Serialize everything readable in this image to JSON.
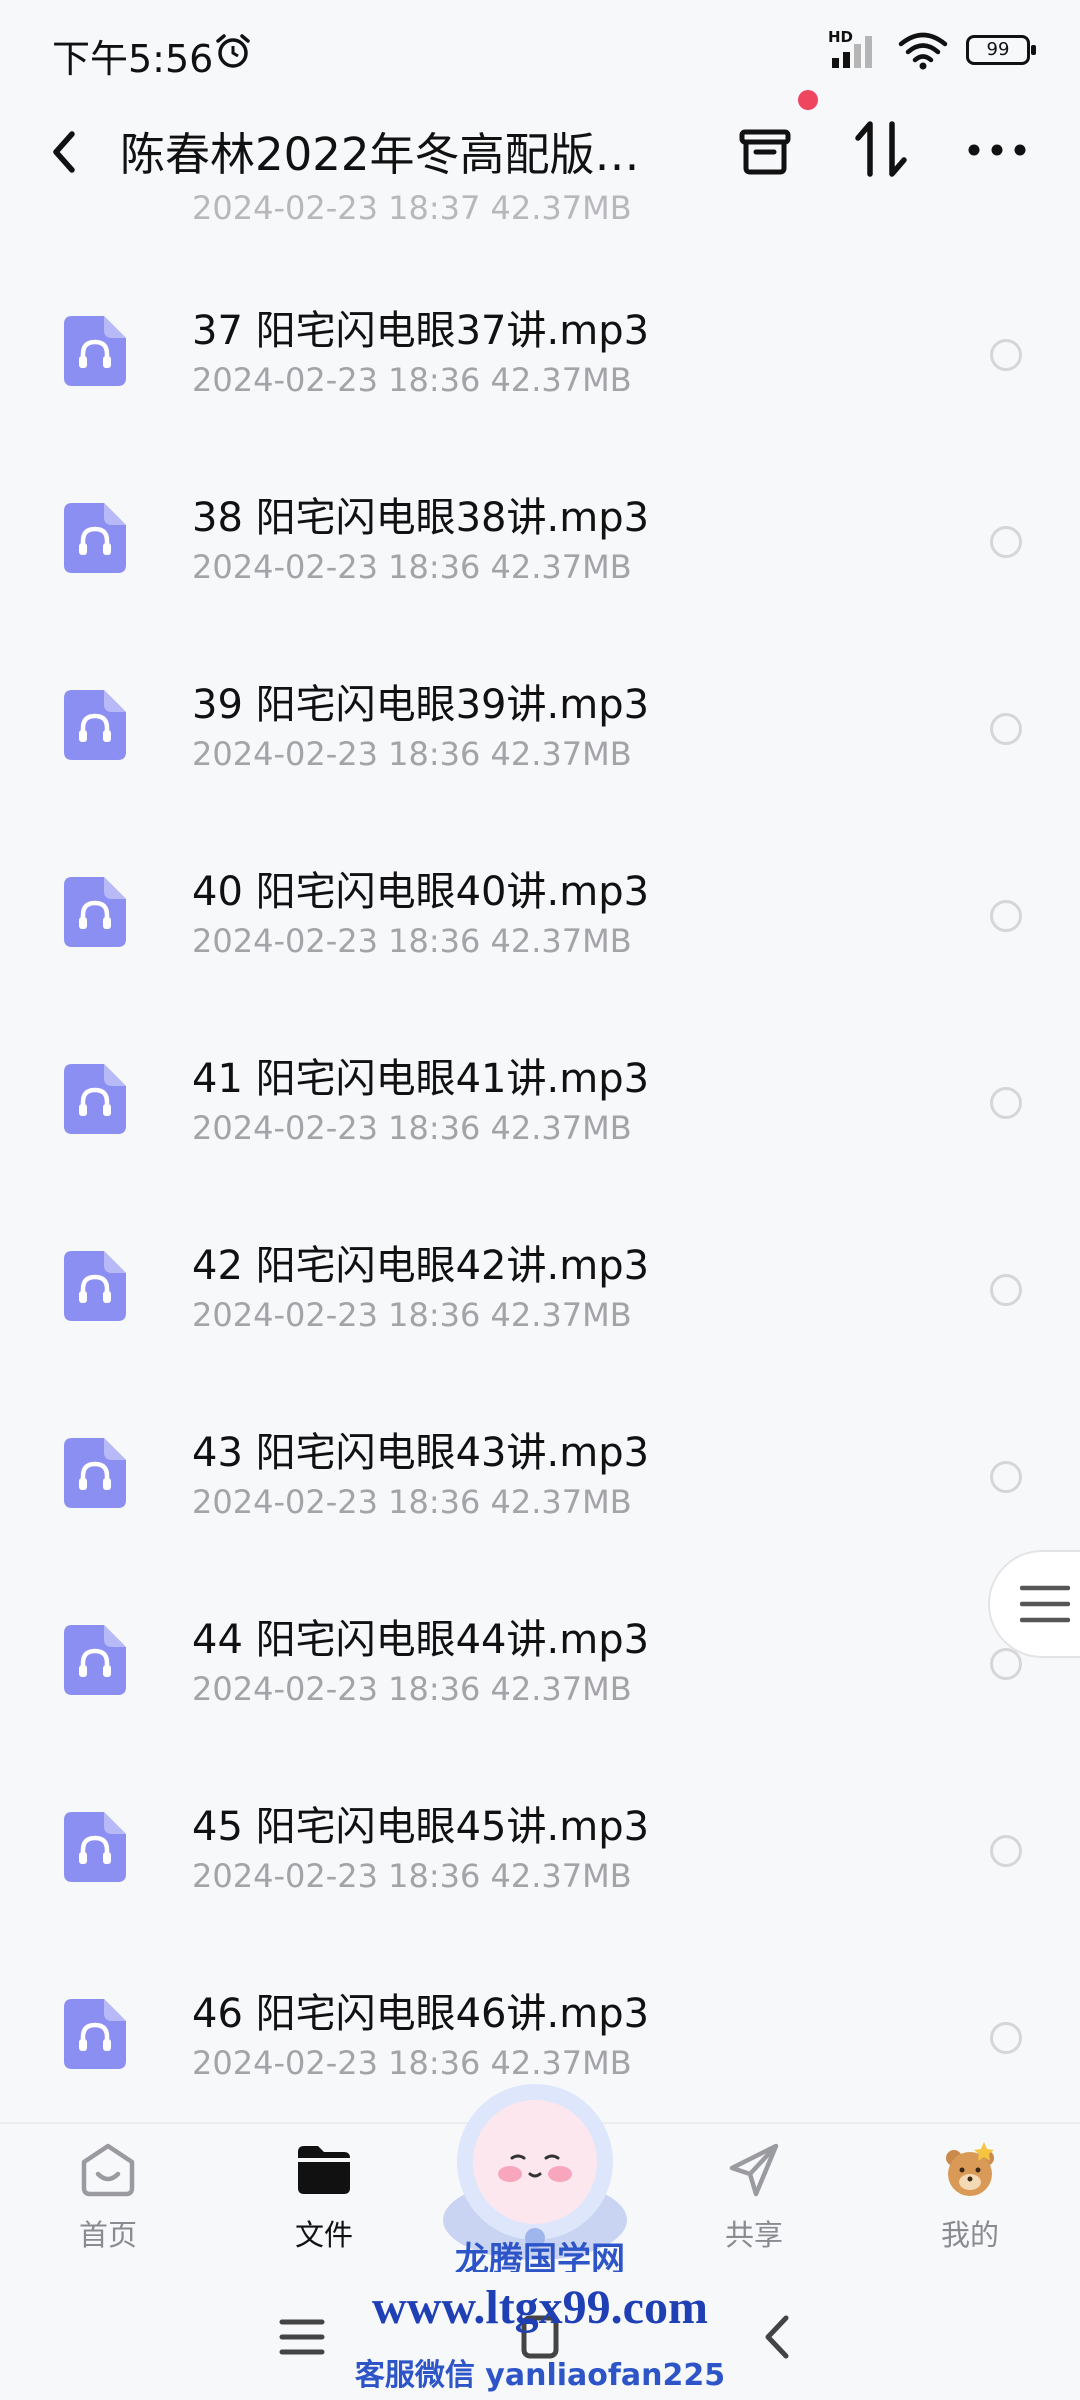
{
  "status": {
    "time": "下午5:56",
    "network": "HD",
    "battery": "99"
  },
  "header": {
    "title": "陈春林2022年冬高配版…"
  },
  "partial_row": {
    "meta": "2024-02-23  18:37  42.37MB"
  },
  "files": [
    {
      "name": "37 阳宅闪电眼37讲.mp3",
      "meta": "2024-02-23  18:36  42.37MB"
    },
    {
      "name": "38 阳宅闪电眼38讲.mp3",
      "meta": "2024-02-23  18:36  42.37MB"
    },
    {
      "name": "39 阳宅闪电眼39讲.mp3",
      "meta": "2024-02-23  18:36  42.37MB"
    },
    {
      "name": "40 阳宅闪电眼40讲.mp3",
      "meta": "2024-02-23  18:36  42.37MB"
    },
    {
      "name": "41 阳宅闪电眼41讲.mp3",
      "meta": "2024-02-23  18:36  42.37MB"
    },
    {
      "name": "42 阳宅闪电眼42讲.mp3",
      "meta": "2024-02-23  18:36  42.37MB"
    },
    {
      "name": "43 阳宅闪电眼43讲.mp3",
      "meta": "2024-02-23  18:36  42.37MB"
    },
    {
      "name": "44 阳宅闪电眼44讲.mp3",
      "meta": "2024-02-23  18:36  42.37MB"
    },
    {
      "name": "45 阳宅闪电眼45讲.mp3",
      "meta": "2024-02-23  18:36  42.37MB"
    },
    {
      "name": "46 阳宅闪电眼46讲.mp3",
      "meta": "2024-02-23  18:36  42.37MB"
    }
  ],
  "tabs": [
    {
      "label": "首页",
      "icon": "home-icon"
    },
    {
      "label": "文件",
      "icon": "folder-icon",
      "active": true
    },
    {
      "label": "共享",
      "icon": "share-icon"
    },
    {
      "label": "我的",
      "icon": "profile-icon"
    }
  ],
  "watermark": {
    "line1": "龙腾国学网",
    "line2": "www.ltgx99.com",
    "line3": "客服微信 yanliaofan225"
  },
  "colors": {
    "accent": "#7b7ff0",
    "file_icon": "#8c8ff2",
    "badge": "#f0455f",
    "watermark": "#1f3fb4"
  }
}
